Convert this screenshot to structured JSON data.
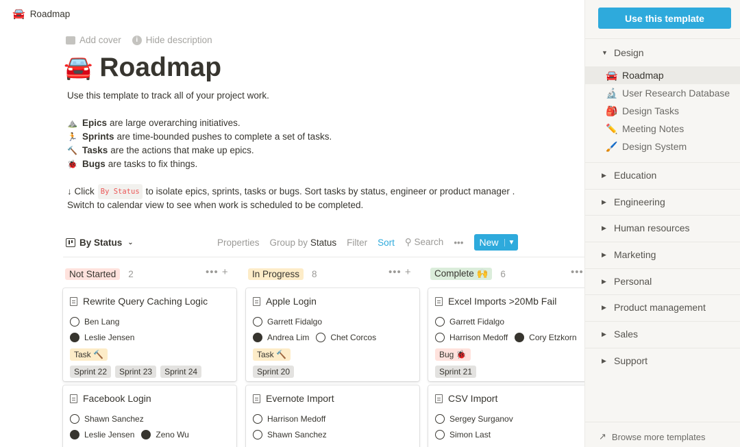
{
  "topbar": {
    "emoji": "🚘",
    "title": "Roadmap"
  },
  "page": {
    "controls": {
      "add_cover": "Add cover",
      "hide_description": "Hide description"
    },
    "emoji": "🚘",
    "title": "Roadmap",
    "intro": "Use this template to track all of your project work.",
    "bullets": [
      {
        "emoji": "⛰️",
        "bold": "Epics",
        "text": "are large overarching initiatives."
      },
      {
        "emoji": "🏃",
        "bold": "Sprints",
        "text": "are time-bounded pushes to complete a set of tasks."
      },
      {
        "emoji": "🔨",
        "bold": "Tasks",
        "text": "are the actions that make up epics."
      },
      {
        "emoji": "🐞",
        "bold": "Bugs",
        "text": "are tasks to fix things."
      }
    ],
    "hint_prefix": "↓ Click",
    "hint_code": "By Status",
    "hint_suffix": "to isolate epics, sprints, tasks or bugs. Sort tasks by status, engineer or product manager .",
    "hint_line2": "Switch to calendar view to see when work is scheduled to be completed."
  },
  "viewbar": {
    "view_name": "By Status",
    "properties": "Properties",
    "group_by": "Group by",
    "group_by_value": "Status",
    "filter": "Filter",
    "sort": "Sort",
    "search": "Search",
    "more": "•••",
    "new": "New"
  },
  "columns": [
    {
      "name": "Not Started",
      "count": "2",
      "color": "#ffe2dd",
      "cards": [
        {
          "title": "Rewrite Query Caching Logic",
          "rows": [
            [
              {
                "name": "Ben Lang",
                "dark": false
              }
            ],
            [
              {
                "name": "Leslie Jensen",
                "dark": true
              }
            ]
          ],
          "tags": [
            {
              "label": "Task 🔨",
              "kind": "task"
            }
          ],
          "sprints": [
            "Sprint 22",
            "Sprint 23",
            "Sprint 24"
          ]
        },
        {
          "title": "Facebook Login",
          "rows": [
            [
              {
                "name": "Shawn Sanchez",
                "dark": false
              }
            ],
            [
              {
                "name": "Leslie Jensen",
                "dark": true
              },
              {
                "name": "Zeno Wu",
                "dark": true
              }
            ]
          ],
          "tags": [],
          "sprints": []
        }
      ]
    },
    {
      "name": "In Progress",
      "count": "8",
      "color": "#fdecc8",
      "cards": [
        {
          "title": "Apple Login",
          "rows": [
            [
              {
                "name": "Garrett Fidalgo",
                "dark": false
              }
            ],
            [
              {
                "name": "Andrea Lim",
                "dark": true
              },
              {
                "name": "Chet Corcos",
                "dark": false
              }
            ]
          ],
          "tags": [
            {
              "label": "Task 🔨",
              "kind": "task"
            }
          ],
          "sprints": [
            "Sprint 20"
          ]
        },
        {
          "title": "Evernote Import",
          "rows": [
            [
              {
                "name": "Harrison Medoff",
                "dark": false
              }
            ],
            [
              {
                "name": "Shawn Sanchez",
                "dark": false
              }
            ]
          ],
          "tags": [],
          "sprints": []
        }
      ]
    },
    {
      "name": "Complete 🙌",
      "count": "6",
      "color": "#dbeddb",
      "cards": [
        {
          "title": "Excel Imports >20Mb Fail",
          "rows": [
            [
              {
                "name": "Garrett Fidalgo",
                "dark": false
              }
            ],
            [
              {
                "name": "Harrison Medoff",
                "dark": false
              },
              {
                "name": "Cory Etzkorn",
                "dark": true
              }
            ]
          ],
          "tags": [
            {
              "label": "Bug 🐞",
              "kind": "bug"
            }
          ],
          "sprints": [
            "Sprint 21"
          ]
        },
        {
          "title": "CSV Import",
          "rows": [
            [
              {
                "name": "Sergey Surganov",
                "dark": false
              }
            ],
            [
              {
                "name": "Simon Last",
                "dark": false
              }
            ]
          ],
          "tags": [],
          "sprints": []
        }
      ]
    }
  ],
  "sidebar": {
    "use_template": "Use this template",
    "design_group": "Design",
    "design_items": [
      {
        "emoji": "🚘",
        "label": "Roadmap",
        "active": true
      },
      {
        "emoji": "🔬",
        "label": "User Research Database",
        "active": false
      },
      {
        "emoji": "🎒",
        "label": "Design Tasks",
        "active": false
      },
      {
        "emoji": "✏️",
        "label": "Meeting Notes",
        "active": false
      },
      {
        "emoji": "🖌️",
        "label": "Design System",
        "active": false
      }
    ],
    "groups": [
      "Education",
      "Engineering",
      "Human resources",
      "Marketing",
      "Personal",
      "Product management",
      "Sales",
      "Support"
    ],
    "browse": "Browse more templates"
  }
}
